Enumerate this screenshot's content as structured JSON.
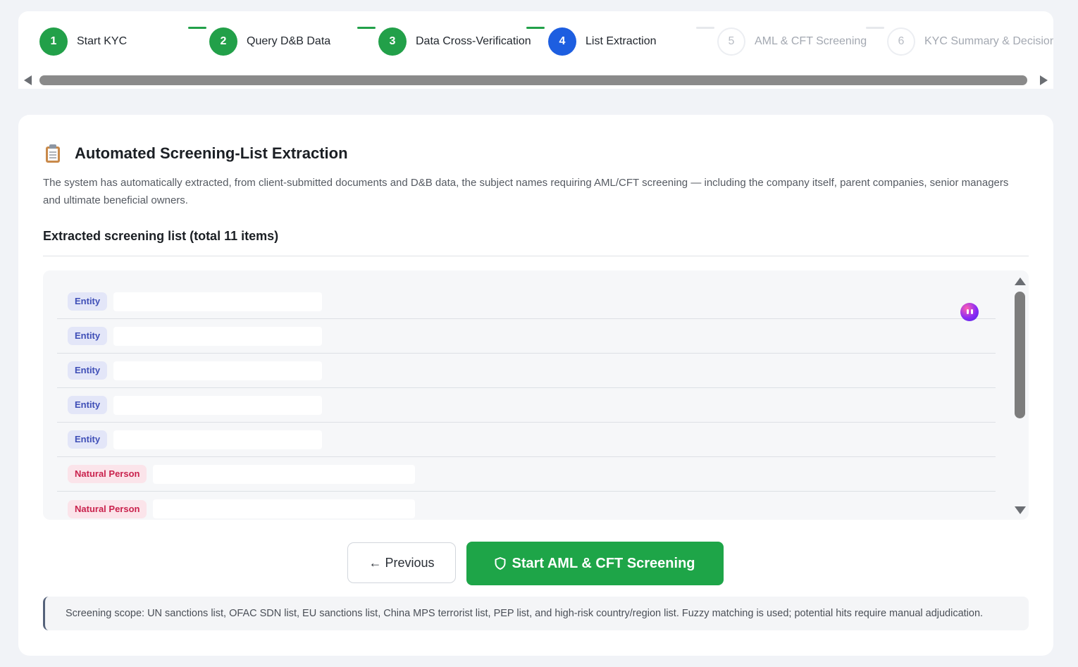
{
  "stepper": {
    "steps": [
      {
        "number": "1",
        "label": "Start KYC",
        "state": "done"
      },
      {
        "number": "2",
        "label": "Query D&B Data",
        "state": "done"
      },
      {
        "number": "3",
        "label": "Data Cross-Verification",
        "state": "done"
      },
      {
        "number": "4",
        "label": "List Extraction",
        "state": "active"
      },
      {
        "number": "5",
        "label": "AML & CFT Screening",
        "state": "pending"
      },
      {
        "number": "6",
        "label": "KYC Summary & Decision",
        "state": "pending"
      }
    ]
  },
  "section": {
    "icon": "clipboard-icon",
    "title": "Automated Screening-List Extraction",
    "description": "The system has automatically extracted, from client-submitted documents and D&B data, the subject names requiring AML/CFT screening — including the company itself, parent companies, senior managers and ultimate beneficial owners."
  },
  "list": {
    "heading": "Extracted screening list (total 11 items)",
    "items": [
      {
        "type": "Entity"
      },
      {
        "type": "Entity"
      },
      {
        "type": "Entity"
      },
      {
        "type": "Entity"
      },
      {
        "type": "Entity"
      },
      {
        "type": "Natural Person"
      },
      {
        "type": "Natural Person"
      }
    ]
  },
  "actions": {
    "previous_label": "← Previous",
    "start_label": "Start AML & CFT Screening"
  },
  "scope_note": "Screening scope: UN sanctions list, OFAC SDN list, EU sanctions list, China MPS terrorist list, PEP list, and high-risk country/region list. Fuzzy matching is used; potential hits require manual adjudication.",
  "colors": {
    "done": "#22a049",
    "active": "#1d5ee0",
    "primary_button": "#1ea548",
    "entity_tag": "#3f4fb7",
    "person_tag": "#c9224d"
  }
}
